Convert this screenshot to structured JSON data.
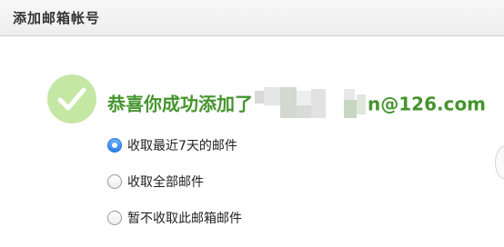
{
  "window": {
    "title": "添加邮箱帐号"
  },
  "success": {
    "message_prefix": "恭喜你成功添加了",
    "email_suffix": "n@126.com",
    "icon": "check-icon",
    "icon_color": "#c5e7a4",
    "text_color": "#45942e"
  },
  "options": [
    {
      "label": "收取最近7天的邮件",
      "selected": true
    },
    {
      "label": "收取全部邮件",
      "selected": false
    },
    {
      "label": "暂不收取此邮箱邮件",
      "selected": false
    }
  ],
  "colors": {
    "radio_selected": "#2b7fe8"
  }
}
